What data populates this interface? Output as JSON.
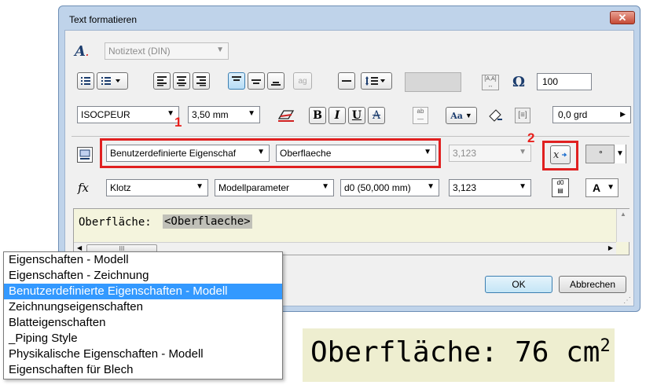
{
  "dialog": {
    "title": "Text formatieren",
    "close_glyph": "✕",
    "style_combo": "Notiztext (DIN)",
    "text_height_pct": "100",
    "font_combo": "ISOCPEUR",
    "size_combo": "3,50 mm",
    "bold_label": "B",
    "italic_label": "I",
    "underline_label": "U",
    "strike_label": "A",
    "rotation_value": "0,0 grd",
    "stack_icon_text": "ab",
    "field_type_combo": "Benutzerdefinierte Eigenschaf",
    "property_combo": "Oberflaeche",
    "precision_combo_disabled": "3,123",
    "precision_combo": "3,123",
    "source_combo": "Klotz",
    "parameter_type_combo": "Modellparameter",
    "parameter_combo": "d0 (50,000 mm)",
    "text_label": "Oberfläche:",
    "text_token": "<Oberflaeche>",
    "scroll_thumb": "III",
    "ok_label": "OK",
    "cancel_label": "Abbrechen",
    "callout_1": "1",
    "callout_2": "2",
    "color_a_label": "A",
    "dot_label": "°",
    "fx_label": "fx"
  },
  "dropdown": {
    "items": [
      "Eigenschaften - Modell",
      "Eigenschaften - Zeichnung",
      "Benutzerdefinierte Eigenschaften - Modell",
      "Zeichnungseigenschaften",
      "Blatteigenschaften",
      "_Piping Style",
      "Physikalische Eigenschaften - Modell",
      "Eigenschaften für Blech"
    ],
    "selected_index": 2
  },
  "preview": {
    "text": "Oberfläche: 76 cm",
    "superscript": "2"
  },
  "colors": {
    "accent_red": "#e02020",
    "selection_blue": "#3399ff",
    "preview_bg": "#eeeed0"
  }
}
